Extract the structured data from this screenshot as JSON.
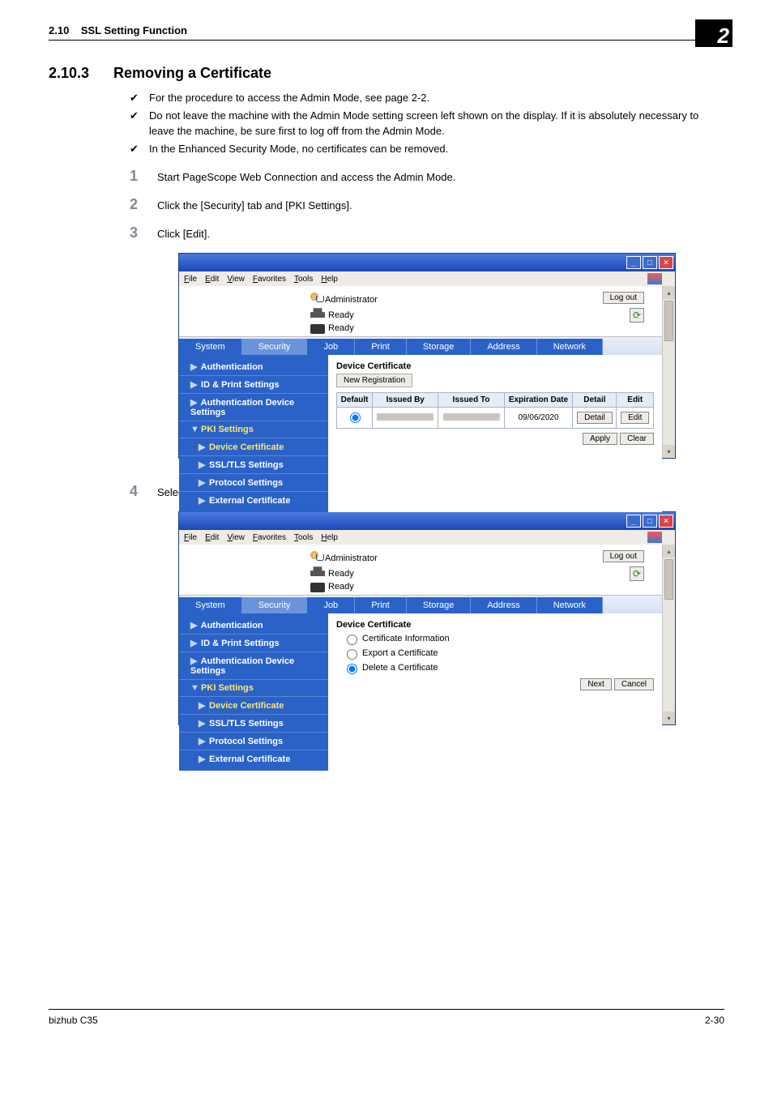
{
  "header": {
    "section_no": "2.10",
    "section_title": "SSL Setting Function",
    "chapter_no": "2"
  },
  "section": {
    "number": "2.10.3",
    "title": "Removing a Certificate"
  },
  "bullets": [
    "For the procedure to access the Admin Mode, see page 2-2.",
    "Do not leave the machine with the Admin Mode setting screen left shown on the display. If it is absolutely necessary to leave the machine, be sure first to log off from the Admin Mode.",
    "In the Enhanced Security Mode, no certificates can be removed."
  ],
  "steps": [
    {
      "n": "1",
      "text": "Start PageScope Web Connection and access the Admin Mode."
    },
    {
      "n": "2",
      "text": "Click the [Security] tab and [PKI Settings]."
    },
    {
      "n": "3",
      "text": "Click [Edit]."
    },
    {
      "n": "4",
      "text": "Select [Delete a Certificate] and click [Next]."
    }
  ],
  "menubar": [
    "File",
    "Edit",
    "View",
    "Favorites",
    "Tools",
    "Help"
  ],
  "common": {
    "admin_label": "Administrator",
    "logout": "Log out",
    "ready": "Ready",
    "tabs": [
      "System",
      "Security",
      "Job",
      "Print",
      "Storage",
      "Address",
      "Network"
    ],
    "sidebar": [
      {
        "label": "Authentication",
        "arrow": "▶"
      },
      {
        "label": "ID & Print Settings",
        "arrow": "▶"
      },
      {
        "label": "Authentication Device Settings",
        "arrow": "▶"
      },
      {
        "label": "PKI Settings",
        "arrow": "▼",
        "active": true
      },
      {
        "label": "Device Certificate",
        "arrow": "▶",
        "active": true,
        "indent": true
      },
      {
        "label": "SSL/TLS Settings",
        "arrow": "▶",
        "indent": true
      },
      {
        "label": "Protocol Settings",
        "arrow": "▶",
        "indent": true
      },
      {
        "label": "External Certificate",
        "arrow": "▶",
        "indent": true
      }
    ]
  },
  "screenshot1": {
    "panel_title": "Device Certificate",
    "new_registration": "New Registration",
    "table_headers": [
      "Default",
      "Issued By",
      "Issued To",
      "Expiration Date",
      "Detail",
      "Edit"
    ],
    "row": {
      "date": "09/06/2020",
      "detail_btn": "Detail",
      "edit_btn": "Edit"
    },
    "apply": "Apply",
    "clear": "Clear"
  },
  "screenshot2": {
    "panel_title": "Device Certificate",
    "options": [
      "Certificate Information",
      "Export a Certificate",
      "Delete a Certificate"
    ],
    "selected": 2,
    "next": "Next",
    "cancel": "Cancel"
  },
  "footer": {
    "left": "bizhub C35",
    "right": "2-30"
  }
}
